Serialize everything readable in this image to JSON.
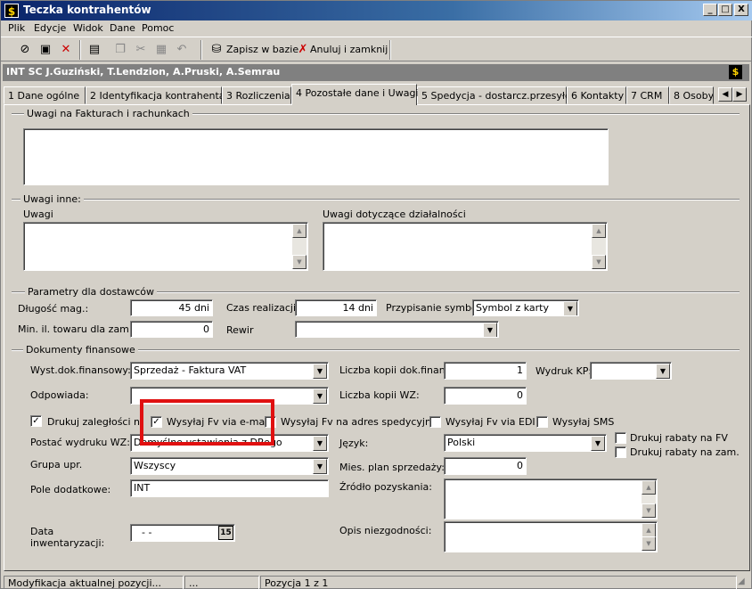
{
  "window": {
    "title": "Teczka kontrahentów",
    "app_icon": "dollar-icon",
    "buttons": [
      "_",
      "□",
      "X"
    ]
  },
  "menu": [
    "Plik",
    "Edycje",
    "Widok",
    "Dane",
    "Pomoc"
  ],
  "toolbar": {
    "save": "Zapisz w bazie",
    "cancel": "Anuluj i zamknij",
    "icons": [
      "find-icon",
      "save-icon",
      "delete-icon",
      "properties-icon",
      "copy-icon",
      "cut-icon",
      "paste-icon",
      "undo-icon"
    ]
  },
  "header": {
    "name": "INT SC J.Guziński, T.Lendzion, A.Pruski, A.Semrau"
  },
  "tabs": [
    "1 Dane ogólne",
    "2 Identyfikacja kontrahenta",
    "3 Rozliczenia",
    "4 Pozostałe dane i Uwagi",
    "5 Spedycja - dostarcz.przesyłek",
    "6 Kontakty",
    "7 CRM",
    "8 Osoby"
  ],
  "active_tab": 3,
  "uwagi_fv": {
    "group": "Uwagi na Fakturach i rachunkach",
    "value": ""
  },
  "uwagi_inne": {
    "group": "Uwagi inne:",
    "uwagi_label": "Uwagi",
    "uwagi_value": "",
    "dzial_label": "Uwagi dotyczące działalności",
    "dzial_value": ""
  },
  "parametry": {
    "group": "Parametry dla dostawców",
    "dlugosc_label": "Długość mag.:",
    "dlugosc_value": "45 dni",
    "czas_label": "Czas realizacji",
    "czas_value": "14 dni",
    "przyp_label": "Przypisanie symboli",
    "przyp_value": "Symbol z karty",
    "min_label": "Min. il. towaru dla zam.",
    "min_value": "0",
    "rewir_label": "Rewir",
    "rewir_value": ""
  },
  "dokumenty": {
    "group": "Dokumenty finansowe",
    "wyst_label": "Wyst.dok.finansowy:",
    "wyst_value": "Sprzedaż - Faktura VAT",
    "kopii_label": "Liczba kopii dok.finans.",
    "kopii_value": "1",
    "wydruk_kp_label": "Wydruk KP:",
    "wydruk_kp_value": "",
    "odpowiada_label": "Odpowiada:",
    "odpowiada_value": "",
    "kopii_wz_label": "Liczba kopii WZ:",
    "kopii_wz_value": "0",
    "cb_zaleglosci": "Drukuj zaległości na FV",
    "cb_email": "Wysyłaj Fv via e-mail",
    "cb_spedycja": "Wysyłaj Fv na adres spedycyjny",
    "cb_edi": "Wysyłaj Fv via EDI",
    "cb_sms": "Wysyłaj SMS",
    "postac_label": "Postać wydruku WZ:",
    "postac_value": "Domyślne ustawienia z DRego",
    "jezyk_label": "Język:",
    "jezyk_value": "Polski",
    "cb_rabaty_fv": "Drukuj rabaty na FV",
    "cb_rabaty_zam": "Drukuj rabaty na zam.",
    "grupa_label": "Grupa upr.",
    "grupa_value": "Wszyscy",
    "plan_label": "Mies. plan sprzedaży:",
    "plan_value": "0",
    "pole_label": "Pole dodatkowe:",
    "pole_value": "INT",
    "zrodlo_label": "Źródło pozyskania:",
    "zrodlo_value": "",
    "data_label": "Data inwentaryzacji:",
    "data_value": "- -",
    "data_btn": "15",
    "opis_label": "Opis niezgodności:",
    "opis_value": ""
  },
  "status": {
    "left": "Modyfikacja aktualnej pozycji...",
    "mid": "...",
    "pos": "Pozycja 1 z 1"
  },
  "colors": {
    "highlight": "#e01010",
    "titlebar": "#0a246a"
  }
}
